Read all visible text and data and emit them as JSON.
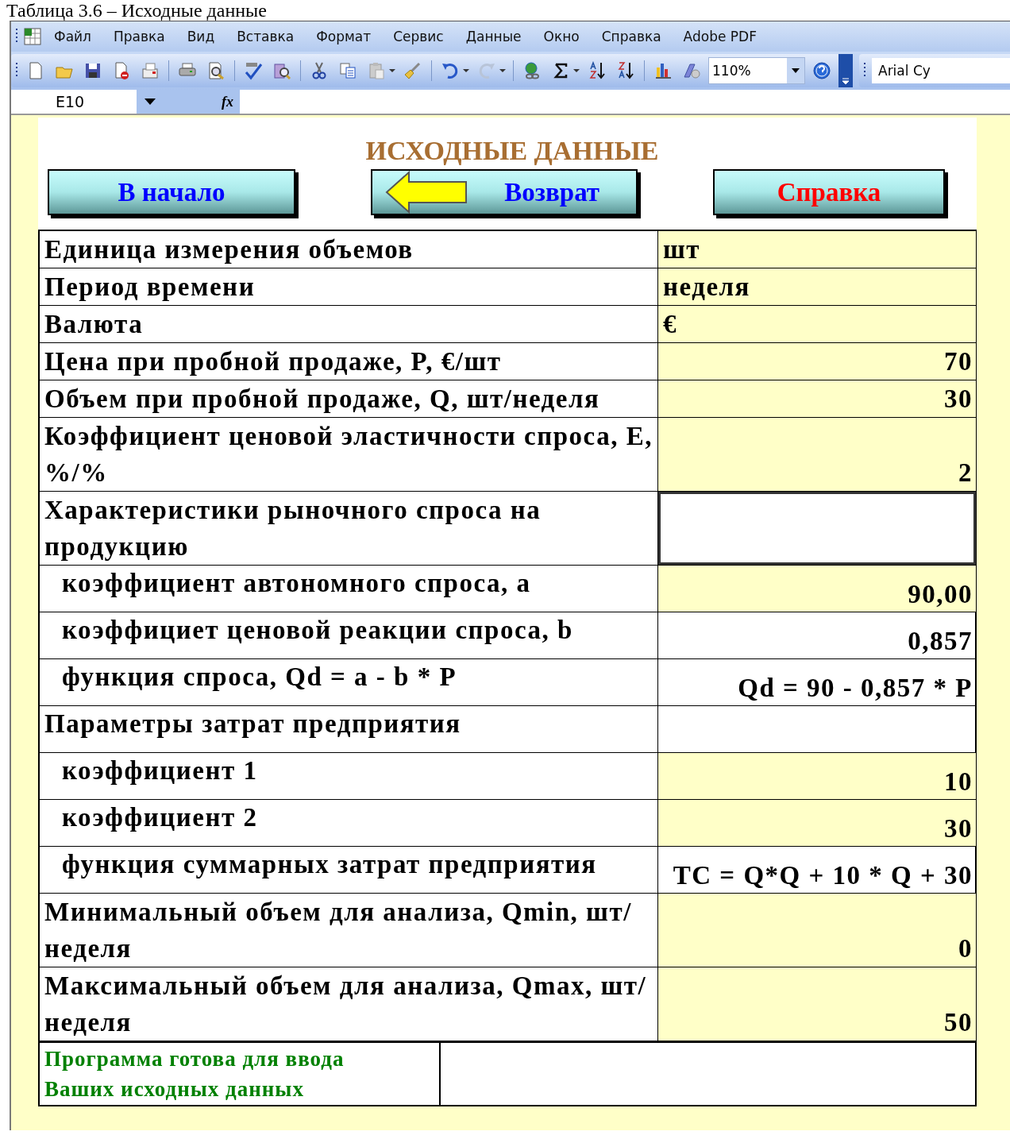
{
  "caption": "Таблица 3.6 – Исходные данные",
  "menu": [
    "Файл",
    "Правка",
    "Вид",
    "Вставка",
    "Формат",
    "Сервис",
    "Данные",
    "Окно",
    "Справка",
    "Adobe PDF"
  ],
  "toolbar": {
    "zoom": "110%",
    "font": "Arial Cy"
  },
  "formula_bar": {
    "cell": "E10",
    "function_label": "fx"
  },
  "sheet": {
    "title": "ИСХОДНЫЕ ДАННЫЕ",
    "buttons": [
      {
        "label": "В начало",
        "color": "#0000ff",
        "kind": "plain"
      },
      {
        "label": "Возврат",
        "color": "#0000ff",
        "kind": "back"
      },
      {
        "label": "Справка",
        "color": "#ff0000",
        "kind": "plain"
      }
    ],
    "rows": [
      {
        "label": "Единица измерения объемов",
        "value": "шт",
        "kind": "maintext",
        "input": true,
        "selected": false
      },
      {
        "label": "Период времени",
        "value": "неделя",
        "kind": "maintext",
        "input": true,
        "selected": false
      },
      {
        "label": "Валюта",
        "value": "€",
        "kind": "maintext",
        "input": true,
        "selected": false
      },
      {
        "label": "Цена при пробной продаже, P, €/шт",
        "value": "70",
        "kind": "main",
        "input": true,
        "selected": false
      },
      {
        "label": "Объем при пробной продаже, Q, шт/неделя",
        "value": "30",
        "kind": "main",
        "input": true,
        "selected": false
      },
      {
        "label": "Коэффициент ценовой эластичности спроса, E, %/%",
        "value": "2",
        "kind": "main",
        "input": true,
        "selected": false
      },
      {
        "label": "Характеристики рыночного спроса на продукцию",
        "kind": "main",
        "input": false,
        "selected": true
      },
      {
        "label": "коэффициент автономного спроса, a",
        "value": "90,00",
        "kind": "sub",
        "input": true,
        "selected": false
      },
      {
        "label": "коэффициет ценовой реакции спроса, b",
        "value": "0,857",
        "kind": "sub",
        "input": false,
        "selected": false
      },
      {
        "label": "функция спроса, Qd = a - b * P",
        "value": "Qd = 90 - 0,857 * P",
        "kind": "sub",
        "input": false,
        "selected": false
      },
      {
        "label": "Параметры затрат предприятия",
        "kind": "mainsub",
        "input": false,
        "selected": false
      },
      {
        "label": "коэффициент 1",
        "value": "10",
        "kind": "sub",
        "input": true,
        "selected": false
      },
      {
        "label": "коэффициент 2",
        "value": "30",
        "kind": "sub",
        "input": true,
        "selected": false
      },
      {
        "label": "функция суммарных затрат предприятия",
        "value": "TC = Q*Q + 10 * Q + 30",
        "kind": "sub",
        "input": false,
        "selected": false
      },
      {
        "label": "Минимальный объем для анализа, Qmin, шт/неделя",
        "value": "0",
        "kind": "main",
        "input": true,
        "selected": false
      },
      {
        "label": "Максимальный объем для анализа, Qmax, шт/неделя",
        "value": "50",
        "kind": "main",
        "input": true,
        "selected": false
      }
    ],
    "status": "Программа готова для ввода\nВаших исходных данных"
  }
}
